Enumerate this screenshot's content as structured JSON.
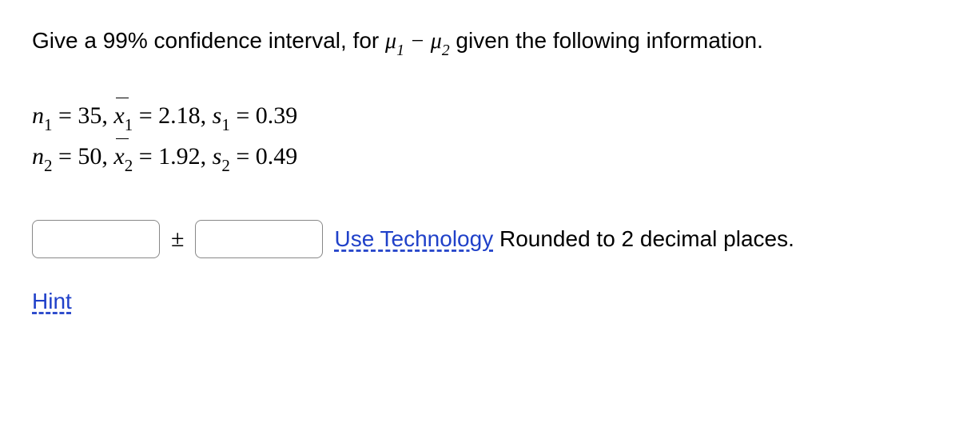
{
  "prompt": {
    "pre": "Give a 99% confidence interval, for ",
    "mu1": "μ",
    "mu1_sub": "1",
    "minus": " − ",
    "mu2": "μ",
    "mu2_sub": "2",
    "post": " given the following information."
  },
  "chart_data": {
    "type": "table",
    "sample1": {
      "n": 35,
      "xbar": 2.18,
      "s": 0.39
    },
    "sample2": {
      "n": 50,
      "xbar": 1.92,
      "s": 0.49
    }
  },
  "row1": {
    "n_label": "n",
    "n_sub": "1",
    "eq1": " = ",
    "n_val": "35",
    "sep1": ", ",
    "x_label": "x",
    "x_sub": "1",
    "eq2": " = ",
    "x_val": "2.18",
    "sep2": ", ",
    "s_label": "s",
    "s_sub": "1",
    "eq3": " = ",
    "s_val": "0.39"
  },
  "row2": {
    "n_label": "n",
    "n_sub": "2",
    "eq1": " = ",
    "n_val": "50",
    "sep1": ", ",
    "x_label": "x",
    "x_sub": "2",
    "eq2": " = ",
    "x_val": "1.92",
    "sep2": ", ",
    "s_label": "s",
    "s_sub": "2",
    "eq3": " = ",
    "s_val": "0.49"
  },
  "answer": {
    "pm": "±",
    "use_tech": "Use Technology",
    "rounded": " Rounded to 2 decimal places."
  },
  "hint": {
    "label": "Hint"
  }
}
